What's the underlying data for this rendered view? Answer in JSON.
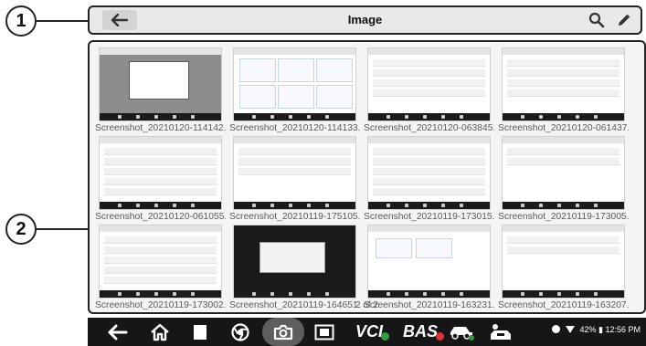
{
  "callouts": {
    "one": "1",
    "two": "2"
  },
  "header": {
    "title": "Image",
    "icons": {
      "back": "back-arrow-icon",
      "search": "search-icon",
      "edit": "pencil-icon"
    }
  },
  "gallery": {
    "items": [
      {
        "caption": "Screenshot_20210120-114142..."
      },
      {
        "caption": "Screenshot_20210120-114133..."
      },
      {
        "caption": "Screenshot_20210120-063845..."
      },
      {
        "caption": "Screenshot_20210120-061437..."
      },
      {
        "caption": "Screenshot_20210120-061055..."
      },
      {
        "caption": "Screenshot_20210119-175105..."
      },
      {
        "caption": "Screenshot_20210119-173015..."
      },
      {
        "caption": "Screenshot_20210119-173005..."
      },
      {
        "caption": "Screenshot_20210119-173002..."
      },
      {
        "caption": "Screenshot_20210119-164651..."
      },
      {
        "caption": "Screenshot_20210119-163231..."
      },
      {
        "caption": "Screenshot_20210119-163207..."
      }
    ],
    "page_indicator": "2 of 2"
  },
  "navbar": {
    "icons": [
      "back-icon",
      "home-icon",
      "recents-icon",
      "chrome-icon",
      "camera-icon",
      "screen-capture-icon",
      "vci-icon",
      "bas-icon",
      "car-icon",
      "car-service-icon"
    ],
    "labels": {
      "vci": "VCI",
      "bas": "BAS"
    },
    "status_text": "42% ▮ 12:56 PM",
    "accent": "#2e9e3e"
  }
}
